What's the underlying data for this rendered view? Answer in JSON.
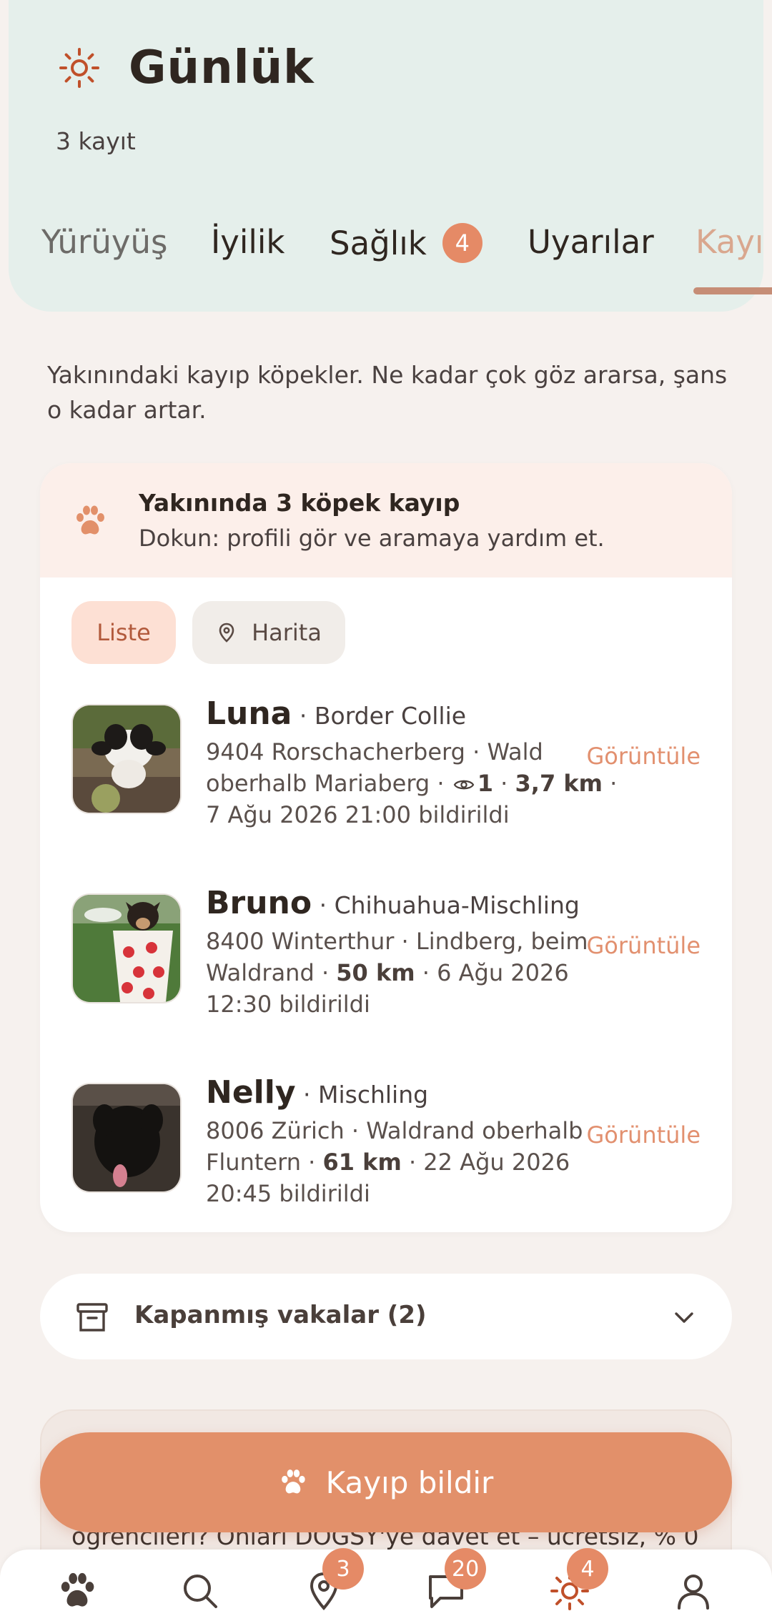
{
  "header": {
    "title": "Günlük",
    "count": "3 kayıt",
    "tabs": [
      {
        "label": "Yürüyüş"
      },
      {
        "label": "İyilik"
      },
      {
        "label": "Sağlık",
        "badge": "4"
      },
      {
        "label": "Uyarılar"
      },
      {
        "label": "Kayı"
      }
    ],
    "active_tab_index": 4
  },
  "intro": "Yakınındaki kayıp köpekler. Ne kadar çok göz ararsa, şans o kadar artar.",
  "lost_card": {
    "alert_title": "Yakınında 3 köpek kayıp",
    "alert_subtitle": "Dokun: profili gör ve aramaya yardım et.",
    "view_toggle": {
      "list": "Liste",
      "map": "Harita",
      "selected": "list"
    },
    "dogs": [
      {
        "name": "Luna",
        "breed": "· Border Collie",
        "location": "9404 Rorschacherberg · Wald oberhalb Mariaberg ·",
        "views": "1",
        "distance": "3,7 km",
        "reported": "· 7 Ağu 2026 21:00 bildirildi",
        "action": "Görüntüle"
      },
      {
        "name": "Bruno",
        "breed": "· Chihuahua-Mischling",
        "location": "8400 Winterthur · Lindberg, beim Waldrand ·",
        "distance": "50 km",
        "reported": "· 6 Ağu 2026 12:30 bildirildi",
        "action": "Görüntüle"
      },
      {
        "name": "Nelly",
        "breed": "· Mischling",
        "location": "8006 Zürich · Waldrand oberhalb Fluntern ·",
        "distance": "61 km",
        "reported": "· 22 Ağu 2026 20:45 bildirildi",
        "action": "Görüntüle"
      }
    ]
  },
  "closed_cases": {
    "label": "Kapanmış vakalar (2)"
  },
  "peek_text": "öğrencileri? Onları DOGSY'ye davet et – ücretsiz, % 0",
  "report_button": "Kayıp bildir",
  "bottom_nav": [
    {
      "icon": "paw-icon"
    },
    {
      "icon": "search-icon"
    },
    {
      "icon": "map-pin-icon",
      "badge": "3"
    },
    {
      "icon": "chat-icon",
      "badge": "20"
    },
    {
      "icon": "sun-icon",
      "badge": "4"
    },
    {
      "icon": "profile-icon"
    }
  ],
  "colors": {
    "accent": "#e2906a",
    "header_bg": "#e5efeb",
    "badge": "#e58a66"
  }
}
